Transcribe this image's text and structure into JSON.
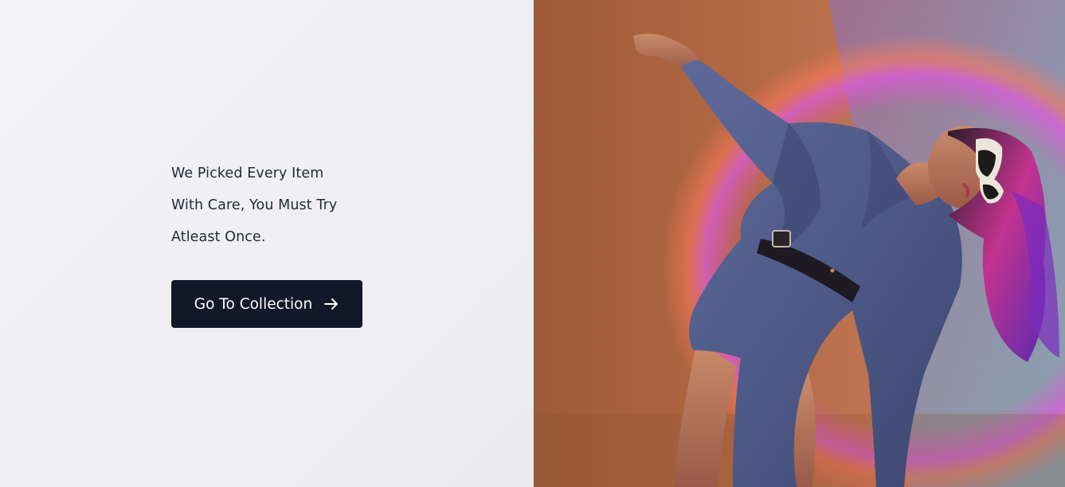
{
  "hero": {
    "tagline_lines": [
      "We Picked Every Item",
      "With Care, You Must Try",
      "Atleast Once."
    ],
    "cta_label": "Go To Collection",
    "cta_icon": "arrow-right-icon"
  },
  "colors": {
    "left_background": "#f0f0f3",
    "text": "#1f2937",
    "button_background": "#111827",
    "button_text": "#ffffff"
  },
  "image": {
    "subject": "fashion-model-photo"
  }
}
